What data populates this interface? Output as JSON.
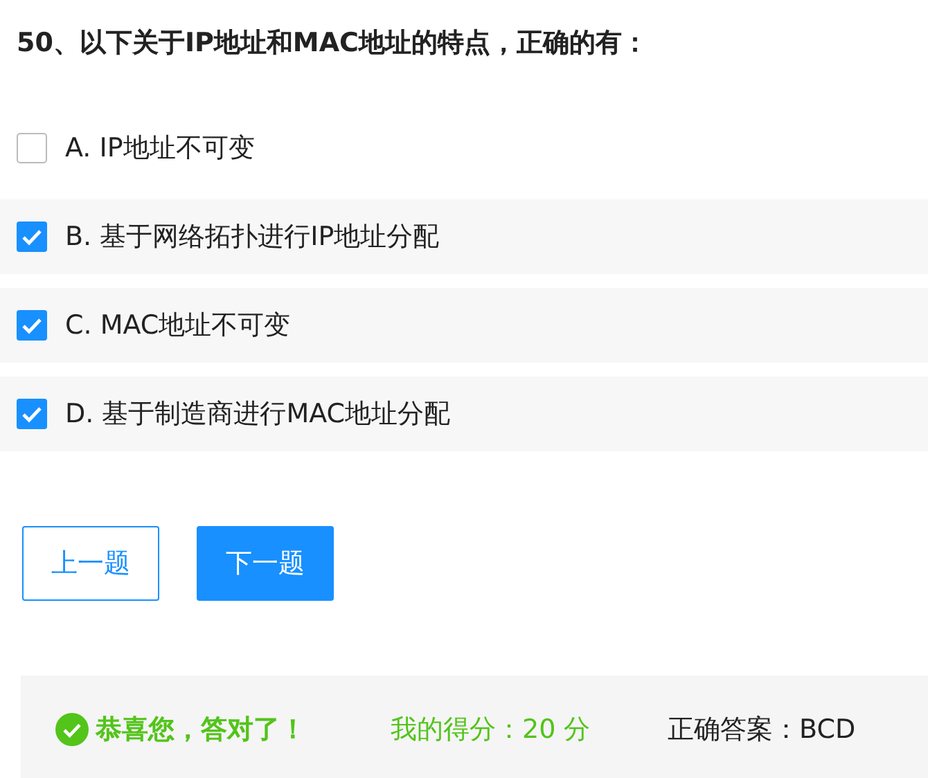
{
  "question": "50、以下关于IP地址和MAC地址的特点，正确的有：",
  "options": [
    {
      "label": "A. IP地址不可变",
      "checked": false
    },
    {
      "label": "B. 基于网络拓扑进行IP地址分配",
      "checked": true
    },
    {
      "label": "C. MAC地址不可变",
      "checked": true
    },
    {
      "label": "D. 基于制造商进行MAC地址分配",
      "checked": true
    }
  ],
  "buttons": [
    {
      "label": "上一题",
      "kind": "outline"
    },
    {
      "label": "下一题",
      "kind": "primary"
    }
  ],
  "result": {
    "message": "恭喜您，答对了！",
    "score": "我的得分：20 分",
    "answer": "正确答案：BCD"
  }
}
